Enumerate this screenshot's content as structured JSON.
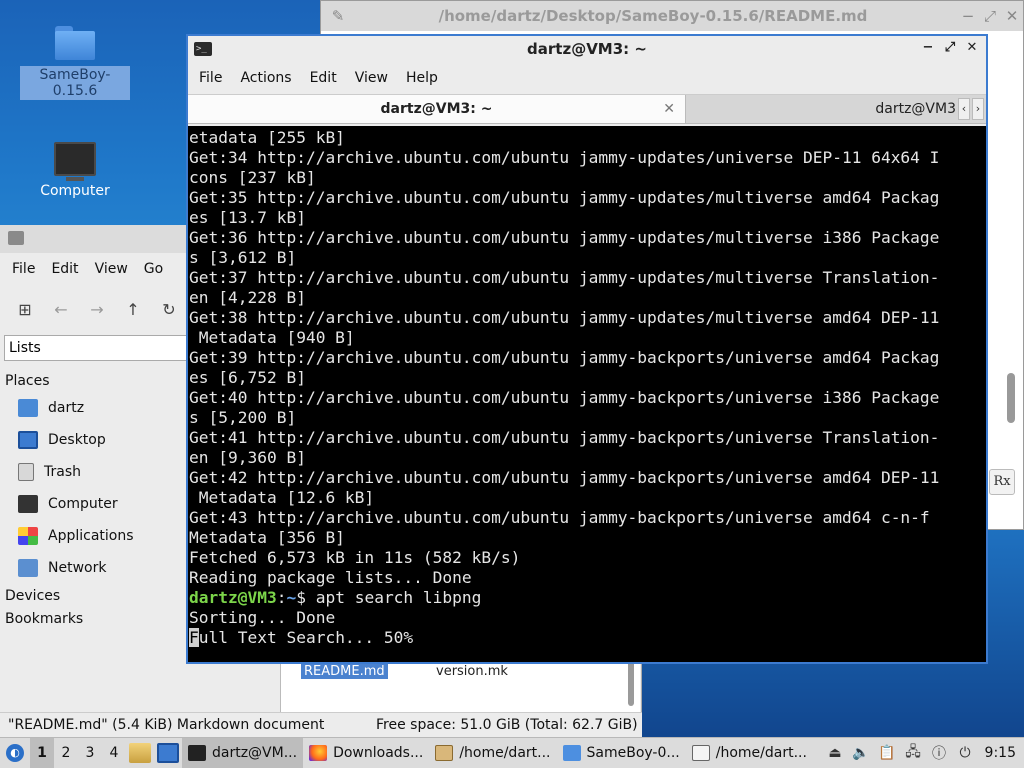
{
  "desktop": {
    "icons": [
      {
        "label": "SameBoy-0.15.6"
      },
      {
        "label": "Computer"
      }
    ]
  },
  "readme_window": {
    "title": "/home/dartz/Desktop/SameBoy-0.15.6/README.md",
    "rx_button": "Rx"
  },
  "file_manager": {
    "menu": [
      "File",
      "Edit",
      "View",
      "Go"
    ],
    "toolbar": {
      "new_tab_icon": "new-tab-icon",
      "back_icon": "arrow-left-icon",
      "forward_icon": "arrow-right-icon",
      "up_icon": "arrow-up-icon",
      "reload_icon": "reload-icon"
    },
    "path_mode": "Lists",
    "places_heading": "Places",
    "places": [
      {
        "label": "dartz",
        "icon": "home-folder-icon"
      },
      {
        "label": "Desktop",
        "icon": "desktop-icon"
      },
      {
        "label": "Trash",
        "icon": "trash-icon"
      },
      {
        "label": "Computer",
        "icon": "computer-icon"
      },
      {
        "label": "Applications",
        "icon": "applications-icon"
      },
      {
        "label": "Network",
        "icon": "network-icon"
      }
    ],
    "devices_heading": "Devices",
    "bookmarks_heading": "Bookmarks",
    "files": [
      "README.md",
      "version.mk"
    ],
    "status_left": "\"README.md\" (5.4 KiB) Markdown document",
    "status_right": "Free space: 51.0 GiB (Total: 62.7 GiB)"
  },
  "terminal": {
    "title": "dartz@VM3: ~",
    "menu": [
      "File",
      "Actions",
      "Edit",
      "View",
      "Help"
    ],
    "tabs": [
      {
        "label": "dartz@VM3: ~",
        "active": true
      },
      {
        "label": "dartz@VM3",
        "active": false
      }
    ],
    "lines": [
      "etadata [255 kB]",
      "Get:34 http://archive.ubuntu.com/ubuntu jammy-updates/universe DEP-11 64x64 I",
      "cons [237 kB]",
      "Get:35 http://archive.ubuntu.com/ubuntu jammy-updates/multiverse amd64 Packag",
      "es [13.7 kB]",
      "Get:36 http://archive.ubuntu.com/ubuntu jammy-updates/multiverse i386 Package",
      "s [3,612 B]",
      "Get:37 http://archive.ubuntu.com/ubuntu jammy-updates/multiverse Translation-",
      "en [4,228 B]",
      "Get:38 http://archive.ubuntu.com/ubuntu jammy-updates/multiverse amd64 DEP-11",
      " Metadata [940 B]",
      "Get:39 http://archive.ubuntu.com/ubuntu jammy-backports/universe amd64 Packag",
      "es [6,752 B]",
      "Get:40 http://archive.ubuntu.com/ubuntu jammy-backports/universe i386 Package",
      "s [5,200 B]",
      "Get:41 http://archive.ubuntu.com/ubuntu jammy-backports/universe Translation-",
      "en [9,360 B]",
      "Get:42 http://archive.ubuntu.com/ubuntu jammy-backports/universe amd64 DEP-11",
      " Metadata [12.6 kB]",
      "Get:43 http://archive.ubuntu.com/ubuntu jammy-backports/universe amd64 c-n-f",
      "Metadata [356 B]",
      "Fetched 6,573 kB in 11s (582 kB/s)",
      "Reading package lists... Done"
    ],
    "prompt_user": "dartz@VM3",
    "prompt_sep": ":",
    "prompt_path": "~",
    "prompt_symbol": "$ ",
    "command": "apt search libpng",
    "after_lines": [
      "Sorting... Done"
    ],
    "cursor_char": "F",
    "last_line_rest": "ull Text Search... 50%"
  },
  "taskbar": {
    "workspaces": [
      "1",
      "2",
      "3",
      "4"
    ],
    "tasks": [
      {
        "label": "dartz@VM...",
        "icon": "terminal-icon",
        "active": true
      },
      {
        "label": "Downloads...",
        "icon": "firefox-icon",
        "active": false
      },
      {
        "label": "/home/dart...",
        "icon": "archive-icon",
        "active": false
      },
      {
        "label": "SameBoy-0...",
        "icon": "folder-icon",
        "active": false
      },
      {
        "label": "/home/dart...",
        "icon": "text-editor-icon",
        "active": false
      }
    ],
    "clock": "9:15"
  },
  "colors": {
    "prompt_user": "#7cd54a",
    "prompt_path": "#6aa3e8",
    "terminal_bg": "#000000",
    "active_border": "#3c7bd0"
  }
}
